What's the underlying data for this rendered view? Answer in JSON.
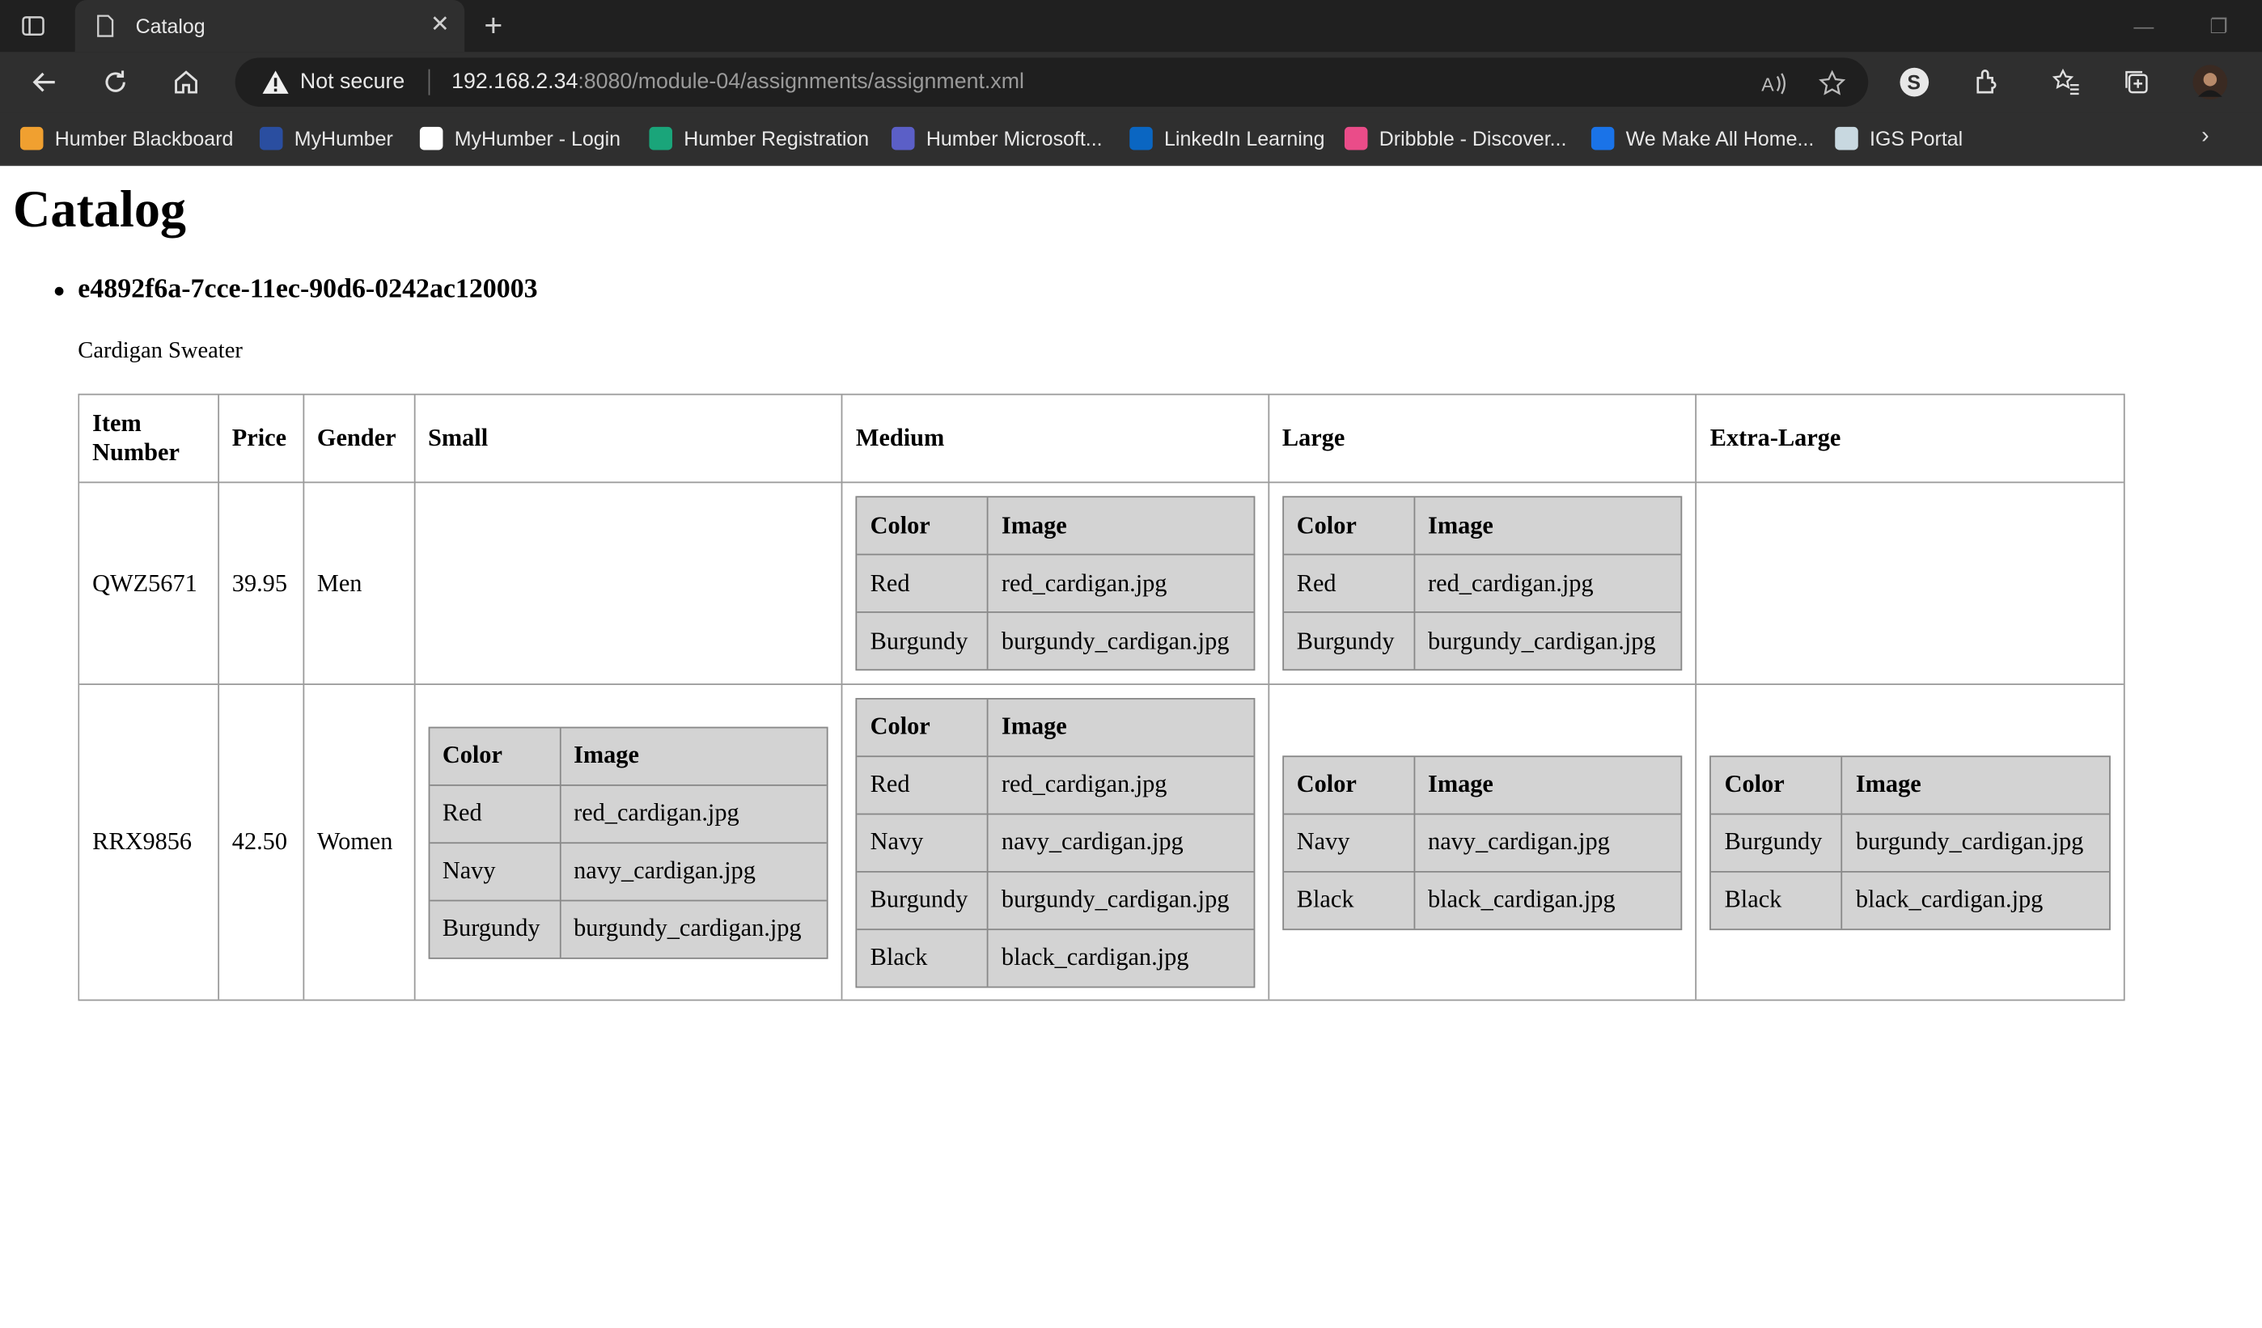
{
  "browser": {
    "tab_title": "Catalog",
    "security_label": "Not secure",
    "url_host": "192.168.2.34",
    "url_rest": ":8080/module-04/assignments/assignment.xml",
    "profile_initial": "S",
    "bookmarks": [
      {
        "label": "Humber Blackboard",
        "color": "#f0a030"
      },
      {
        "label": "MyHumber",
        "color": "#2a4ea0"
      },
      {
        "label": "MyHumber - Login",
        "color": "#ffffff"
      },
      {
        "label": "Humber Registration",
        "color": "#1aa57a"
      },
      {
        "label": "Humber Microsoft...",
        "color": "#5b5fc7"
      },
      {
        "label": "LinkedIn Learning",
        "color": "#0a66c2"
      },
      {
        "label": "Dribbble - Discover...",
        "color": "#ea4c89"
      },
      {
        "label": "We Make All Home...",
        "color": "#1a73e8"
      },
      {
        "label": "IGS Portal",
        "color": "#c8d8e0"
      }
    ]
  },
  "page": {
    "title": "Catalog",
    "product_id": "e4892f6a-7cce-11ec-90d6-0242ac120003",
    "description": "Cardigan Sweater",
    "headers": [
      "Item Number",
      "Price",
      "Gender",
      "Small",
      "Medium",
      "Large",
      "Extra-Large"
    ],
    "inner_headers": [
      "Color",
      "Image"
    ],
    "items": [
      {
        "item_number": "QWZ5671",
        "price": "39.95",
        "gender": "Men",
        "sizes": [
          [],
          [
            [
              "Red",
              "red_cardigan.jpg"
            ],
            [
              "Burgundy",
              "burgundy_cardigan.jpg"
            ]
          ],
          [
            [
              "Red",
              "red_cardigan.jpg"
            ],
            [
              "Burgundy",
              "burgundy_cardigan.jpg"
            ]
          ],
          []
        ]
      },
      {
        "item_number": "RRX9856",
        "price": "42.50",
        "gender": "Women",
        "sizes": [
          [
            [
              "Red",
              "red_cardigan.jpg"
            ],
            [
              "Navy",
              "navy_cardigan.jpg"
            ],
            [
              "Burgundy",
              "burgundy_cardigan.jpg"
            ]
          ],
          [
            [
              "Red",
              "red_cardigan.jpg"
            ],
            [
              "Navy",
              "navy_cardigan.jpg"
            ],
            [
              "Burgundy",
              "burgundy_cardigan.jpg"
            ],
            [
              "Black",
              "black_cardigan.jpg"
            ]
          ],
          [
            [
              "Navy",
              "navy_cardigan.jpg"
            ],
            [
              "Black",
              "black_cardigan.jpg"
            ]
          ],
          [
            [
              "Burgundy",
              "burgundy_cardigan.jpg"
            ],
            [
              "Black",
              "black_cardigan.jpg"
            ]
          ]
        ]
      }
    ]
  }
}
